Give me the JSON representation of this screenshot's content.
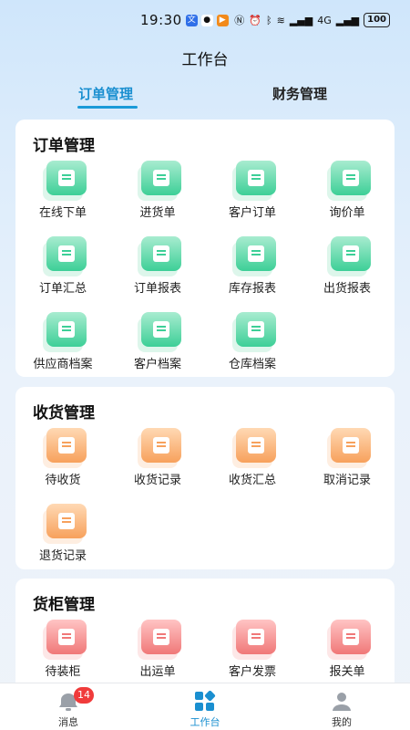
{
  "status_bar": {
    "time": "19:30",
    "battery": "100",
    "network_label": "4G"
  },
  "header": {
    "title": "工作台"
  },
  "tabs": [
    {
      "label": "订单管理",
      "active": true
    },
    {
      "label": "财务管理",
      "active": false
    }
  ],
  "sections": {
    "order": {
      "title": "订单管理",
      "items": [
        "在线下单",
        "进货单",
        "客户订单",
        "询价单",
        "订单汇总",
        "订单报表",
        "库存报表",
        "出货报表",
        "供应商档案",
        "客户档案",
        "仓库档案"
      ]
    },
    "receive": {
      "title": "收货管理",
      "items": [
        "待收货",
        "收货记录",
        "收货汇总",
        "取消记录",
        "退货记录"
      ]
    },
    "container": {
      "title": "货柜管理",
      "items": [
        "待装柜",
        "出运单",
        "客户发票",
        "报关单"
      ]
    }
  },
  "bottom_nav": [
    {
      "label": "消息",
      "badge": "14",
      "icon": "message-icon"
    },
    {
      "label": "工作台",
      "icon": "workbench-icon",
      "active": true
    },
    {
      "label": "我的",
      "icon": "profile-icon"
    }
  ],
  "colors": {
    "accent": "#1a8fd0",
    "green": "#3dcf97",
    "orange": "#f7a15c",
    "red": "#f07878",
    "badge": "#f03b3b"
  }
}
